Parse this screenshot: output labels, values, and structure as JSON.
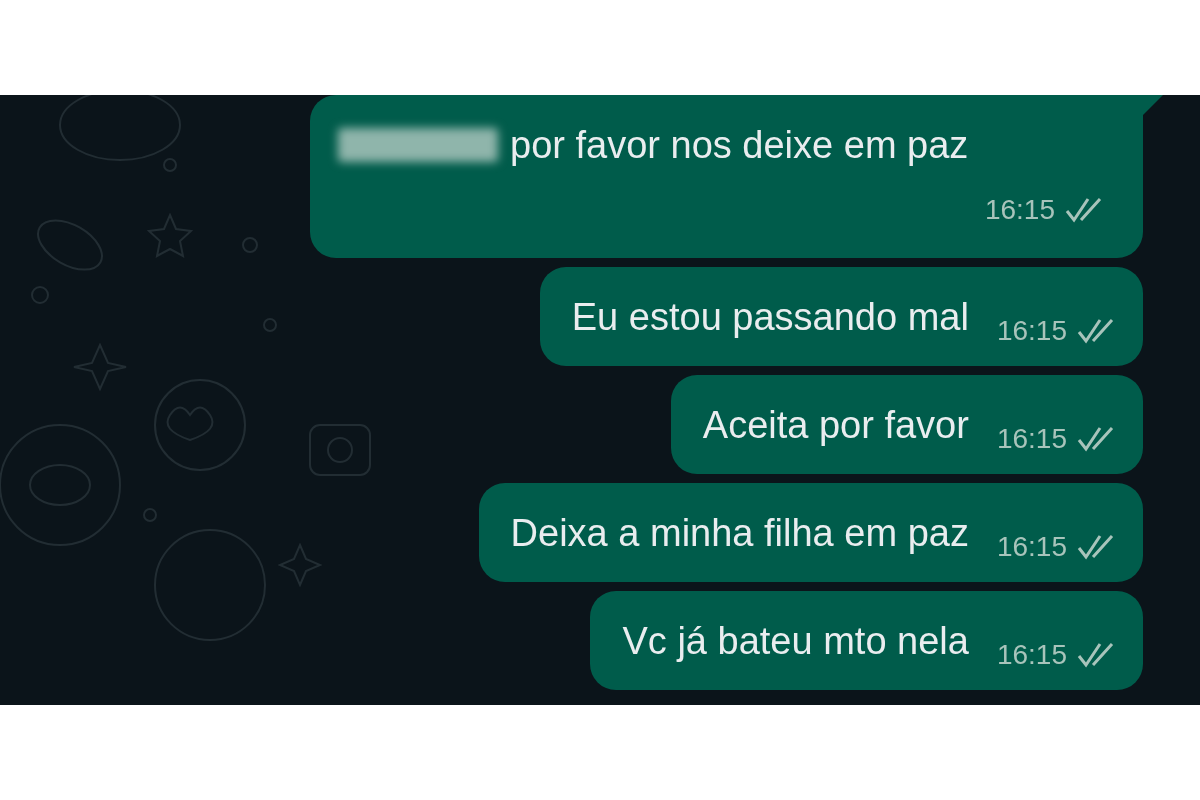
{
  "messages": [
    {
      "kind": "stacked",
      "redacted": true,
      "text": "por favor nos deixe em paz",
      "time": "16:15",
      "read": true,
      "tail": true
    },
    {
      "kind": "inline",
      "redacted": false,
      "text": "Eu estou passando mal",
      "time": "16:15",
      "read": true,
      "tail": false
    },
    {
      "kind": "inline",
      "redacted": false,
      "text": "Aceita por favor",
      "time": "16:15",
      "read": true,
      "tail": false
    },
    {
      "kind": "inline",
      "redacted": false,
      "text": "Deixa a minha filha em paz",
      "time": "16:15",
      "read": true,
      "tail": false
    },
    {
      "kind": "inline",
      "redacted": false,
      "text": "Vc já bateu mto nela",
      "time": "16:15",
      "read": true,
      "tail": false
    }
  ]
}
